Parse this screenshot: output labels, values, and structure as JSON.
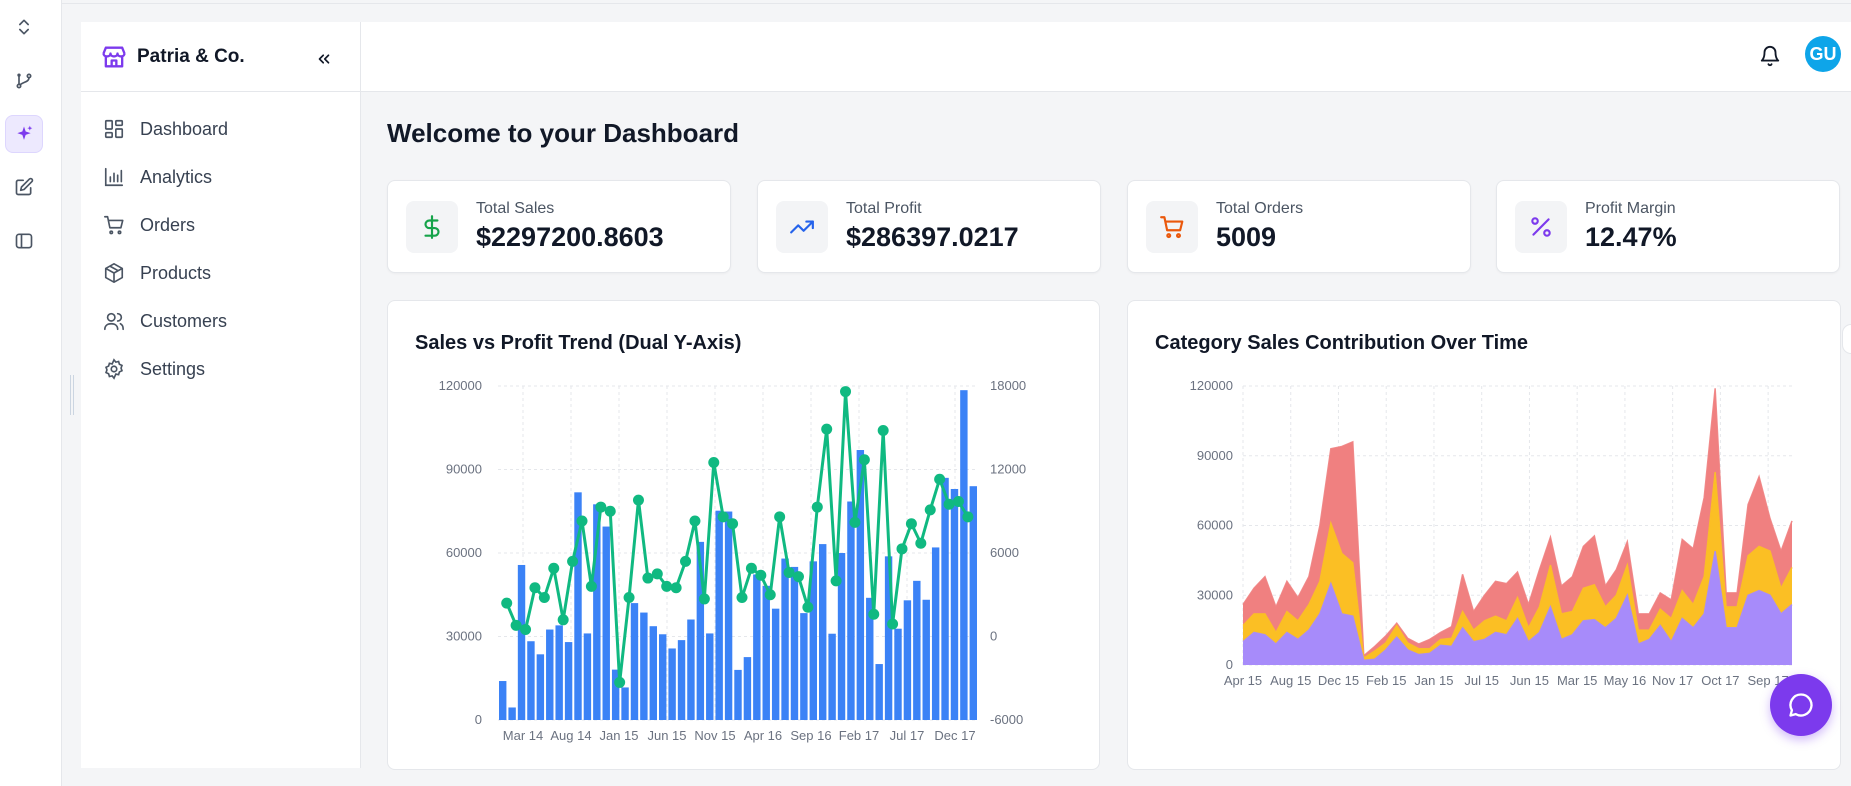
{
  "brand": {
    "name": "Patria & Co.",
    "icon": "storefront-icon"
  },
  "rail": {
    "icons": [
      "chevron-up-down-icon",
      "git-branch-icon",
      "sparkles-icon",
      "edit-icon",
      "panel-icon"
    ]
  },
  "sidebar": {
    "items": [
      {
        "label": "Dashboard",
        "icon": "dashboard-icon"
      },
      {
        "label": "Analytics",
        "icon": "bar-chart-icon"
      },
      {
        "label": "Orders",
        "icon": "cart-icon"
      },
      {
        "label": "Products",
        "icon": "box-icon"
      },
      {
        "label": "Customers",
        "icon": "users-icon"
      },
      {
        "label": "Settings",
        "icon": "gear-icon"
      }
    ]
  },
  "header": {
    "avatar_initials": "GU"
  },
  "main": {
    "title": "Welcome to your Dashboard",
    "kpis": [
      {
        "label": "Total Sales",
        "value": "$2297200.8603",
        "icon": "dollar-icon",
        "color": "#16a34a"
      },
      {
        "label": "Total Profit",
        "value": "$286397.0217",
        "icon": "trend-up-icon",
        "color": "#2563eb"
      },
      {
        "label": "Total Orders",
        "value": "5009",
        "icon": "cart-icon",
        "color": "#ea580c"
      },
      {
        "label": "Profit Margin",
        "value": "12.47%",
        "icon": "percent-icon",
        "color": "#7c3aed"
      }
    ]
  },
  "chart_data": [
    {
      "type": "bar+line",
      "title": "Sales vs Profit Trend (Dual Y-Axis)",
      "x_tick_labels": [
        "Mar 14",
        "Aug 14",
        "Jan 15",
        "Jun 15",
        "Nov 15",
        "Apr 16",
        "Sep 16",
        "Feb 17",
        "Jul 17",
        "Dec 17"
      ],
      "y_left": {
        "ticks": [
          0,
          30000,
          60000,
          90000,
          120000
        ],
        "range": [
          0,
          120000
        ]
      },
      "y_right": {
        "ticks": [
          -6000,
          0,
          6000,
          12000,
          18000
        ],
        "range": [
          -6000,
          18000
        ]
      },
      "grid": true,
      "series": [
        {
          "kind": "bar",
          "color": "#3b82f6",
          "values": [
            14000,
            4500,
            55700,
            28300,
            23600,
            32500,
            34000,
            28000,
            81800,
            31100,
            77500,
            69500,
            18100,
            11700,
            42000,
            38600,
            33700,
            30800,
            25700,
            28700,
            36100,
            64000,
            31100,
            75200,
            74900,
            18000,
            22600,
            52300,
            48200,
            40000,
            58000,
            55000,
            38400,
            57000,
            63200,
            31000,
            60000,
            78500,
            97000,
            43900,
            20100,
            58800,
            32800,
            43000,
            50000,
            43200,
            62000,
            87000,
            83000,
            118500,
            84000
          ]
        },
        {
          "kind": "line",
          "color": "#10b981",
          "values": [
            2400,
            800,
            500,
            3500,
            2800,
            4900,
            1200,
            5400,
            8300,
            3600,
            9300,
            9000,
            -3300,
            2800,
            9800,
            4200,
            4500,
            3600,
            3500,
            5400,
            8300,
            2700,
            12500,
            8600,
            8100,
            2800,
            4900,
            4400,
            3000,
            8600,
            4600,
            4300,
            2100,
            9300,
            14900,
            4000,
            17600,
            8200,
            12700,
            1600,
            14800,
            900,
            6300,
            8100,
            6700,
            9100,
            11300,
            9500,
            9700,
            8600
          ]
        }
      ]
    },
    {
      "type": "area",
      "title": "Category Sales Contribution Over Time",
      "x_tick_labels": [
        "Apr 15",
        "Aug 15",
        "Dec 15",
        "Feb 15",
        "Jan 15",
        "Jul 15",
        "Jun 15",
        "Mar 15",
        "May 16",
        "Nov 17",
        "Oct 17",
        "Sep 17"
      ],
      "y": {
        "ticks": [
          0,
          30000,
          60000,
          90000,
          120000
        ],
        "range": [
          0,
          120000
        ]
      },
      "grid": true,
      "stacked": true,
      "series": [
        {
          "color": "#a78bfa",
          "values": [
            10000,
            14000,
            13000,
            9000,
            14000,
            11000,
            15000,
            22000,
            35000,
            22000,
            21000,
            2000,
            2500,
            6500,
            12000,
            6500,
            4500,
            5000,
            8500,
            8000,
            16000,
            10000,
            11000,
            14000,
            13000,
            20000,
            10000,
            14000,
            25000,
            11000,
            13000,
            19000,
            19500,
            16000,
            20000,
            30000,
            9000,
            11000,
            17000,
            10000,
            20000,
            16000,
            22000,
            49000,
            16000,
            16000,
            30000,
            32000,
            30000,
            22000,
            26000
          ]
        },
        {
          "color": "#fbbf24",
          "values": [
            7000,
            8000,
            9000,
            5000,
            9000,
            8000,
            11000,
            14000,
            26000,
            26000,
            23000,
            1000,
            3500,
            3000,
            5000,
            3000,
            2500,
            2000,
            2500,
            3500,
            7000,
            5000,
            8000,
            7000,
            6000,
            9000,
            6000,
            11000,
            18000,
            11000,
            10000,
            14000,
            15000,
            9000,
            10000,
            13000,
            6000,
            4000,
            7000,
            10000,
            12000,
            10000,
            16000,
            34000,
            9000,
            9000,
            17000,
            19000,
            19000,
            11000,
            16000
          ]
        },
        {
          "color": "#f08080",
          "values": [
            9000,
            11000,
            16000,
            11000,
            13000,
            10000,
            12000,
            24000,
            32000,
            46000,
            52000,
            1000,
            2000,
            3000,
            1000,
            2000,
            2000,
            4000,
            3000,
            5000,
            16000,
            8000,
            11000,
            15000,
            16000,
            11000,
            10000,
            16000,
            12000,
            12000,
            15000,
            18000,
            21000,
            9000,
            11000,
            10000,
            7000,
            7000,
            7000,
            8000,
            22000,
            24000,
            34000,
            36000,
            6000,
            6000,
            22000,
            30000,
            14000,
            16000,
            20000
          ]
        }
      ]
    }
  ]
}
